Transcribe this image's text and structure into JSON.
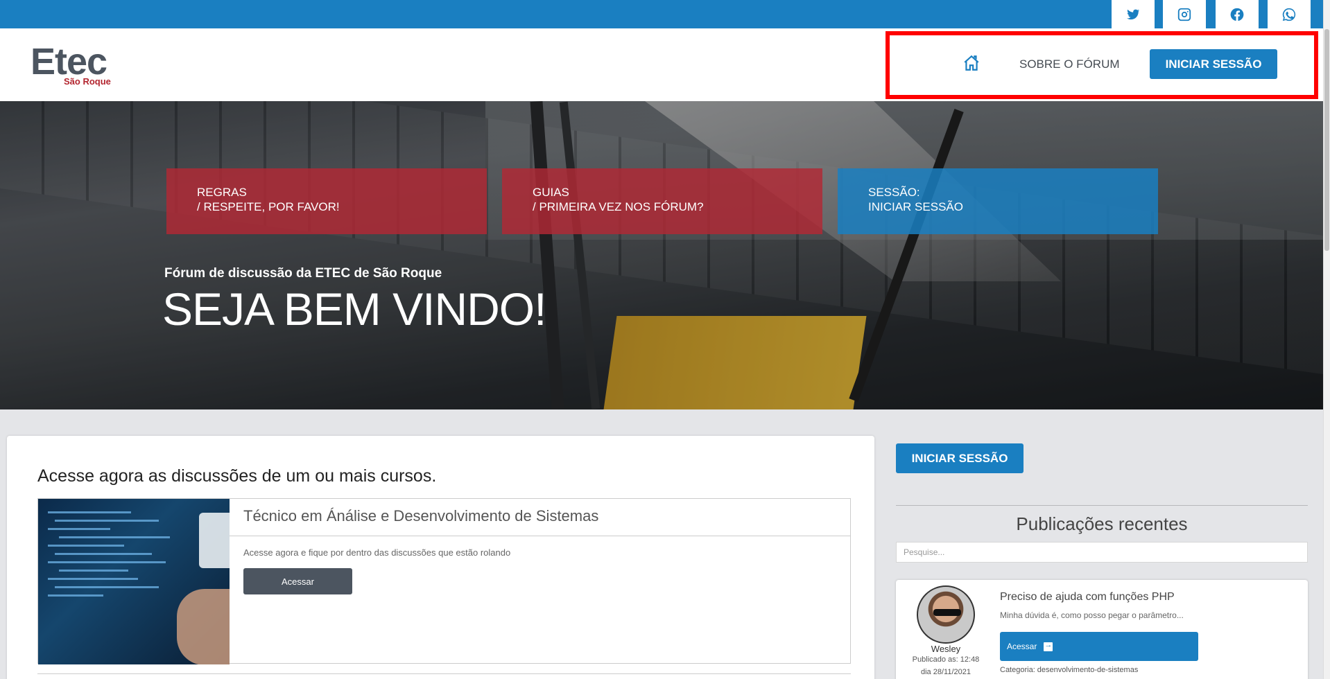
{
  "social": {
    "items": [
      {
        "name": "twitter",
        "icon": "twitter-icon"
      },
      {
        "name": "instagram",
        "icon": "instagram-icon"
      },
      {
        "name": "facebook",
        "icon": "facebook-icon"
      },
      {
        "name": "whatsapp",
        "icon": "whatsapp-icon"
      }
    ]
  },
  "header": {
    "logo_main": "Etec",
    "logo_sub": "São Roque",
    "nav": {
      "home_icon": "home-icon",
      "about_label": "SOBRE O FÓRUM",
      "login_label": "INICIAR SESSÃO"
    }
  },
  "hero": {
    "cards": [
      {
        "line1": "REGRAS",
        "line2": "/ RESPEITE, POR FAVOR!"
      },
      {
        "line1": "GUIAS",
        "line2": "/ PRIMEIRA VEZ NOS FÓRUM?"
      },
      {
        "line1": "SESSÃO:",
        "line2": "INICIAR SESSÃO"
      }
    ],
    "subtitle": "Fórum de discussão da ETEC de São Roque",
    "title": "SEJA BEM VINDO!"
  },
  "main": {
    "heading": "Acesse agora as discussões de um ou mais cursos.",
    "course": {
      "title": "Técnico em Ánálise e Desenvolvimento de Sistemas",
      "description": "Acesse agora e fique por dentro das discussões que estão rolando",
      "button_label": "Acessar"
    }
  },
  "sidebar": {
    "login_label": "INICIAR SESSÃO",
    "heading": "Publicações recentes",
    "search_placeholder": "Pesquise...",
    "post": {
      "author": "Wesley",
      "time": "Publicado as: 12:48",
      "date": "dia 28/11/2021",
      "title": "Preciso de ajuda com funções PHP",
      "excerpt": "Minha dúvida é, como posso pegar o parâmetro...",
      "button_label": "Acessar",
      "category": "Categoria: desenvolvimento-de-sistemas"
    }
  },
  "colors": {
    "brand_blue": "#1a7fc1",
    "brand_red": "#b32834",
    "highlight": "#ff0000",
    "dark_button": "#4c5560"
  }
}
